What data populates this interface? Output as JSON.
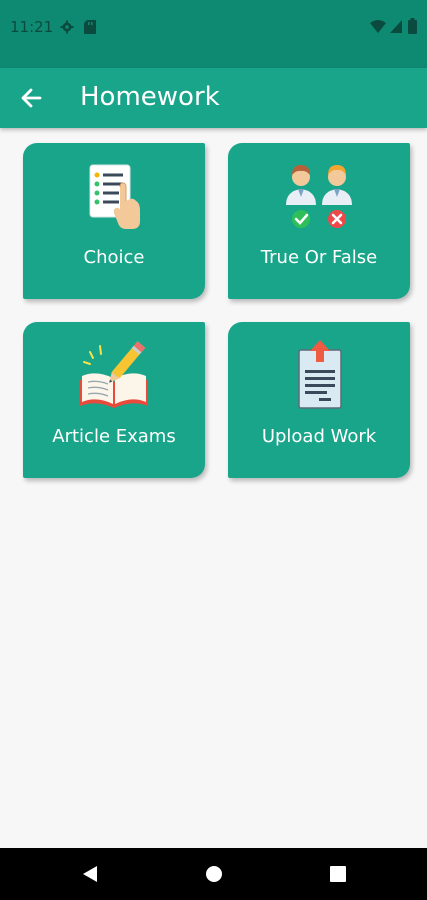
{
  "status_bar": {
    "time": "11:21",
    "icons": [
      "gear-icon",
      "sd-card-icon",
      "wifi-icon",
      "signal-icon",
      "battery-icon"
    ]
  },
  "app_bar": {
    "title": "Homework",
    "back_icon": "arrow-left-icon"
  },
  "cards": [
    {
      "label": "Choice",
      "icon": "checklist-hand-icon"
    },
    {
      "label": "True Or False",
      "icon": "two-people-check-cross-icon"
    },
    {
      "label": "Article Exams",
      "icon": "book-pencil-icon"
    },
    {
      "label": "Upload Work",
      "icon": "upload-document-icon"
    }
  ],
  "nav_bar": {
    "icons": [
      "back-triangle-icon",
      "home-circle-icon",
      "recents-square-icon"
    ]
  },
  "colors": {
    "primary": "#19a58a",
    "status_bar": "#0f8a72",
    "background": "#f7f7f7"
  }
}
